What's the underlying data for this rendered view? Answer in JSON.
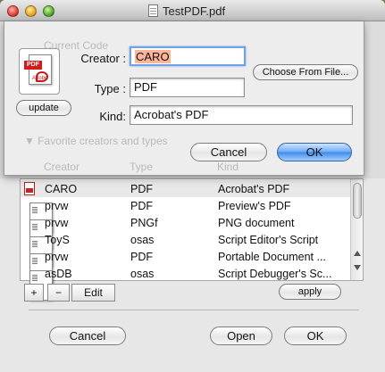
{
  "window": {
    "title": "TestPDF.pdf"
  },
  "background": {
    "ghost_label": "Current Code",
    "ghost_section": "▼ Favorite creators and types",
    "ghost_col1": "Creator",
    "ghost_col2": "Type",
    "ghost_col3": "Kind",
    "rows": [
      {
        "creator": "CARO",
        "type": "PDF",
        "kind": "Acrobat's PDF",
        "icon": "pdf-icon"
      },
      {
        "creator": "prvw",
        "type": "PDF",
        "kind": "Preview's PDF",
        "icon": "document-icon"
      },
      {
        "creator": "prvw",
        "type": "PNGf",
        "kind": "PNG document",
        "icon": "document-icon"
      },
      {
        "creator": "ToyS",
        "type": "osas",
        "kind": "Script Editor's Script",
        "icon": "document-icon"
      },
      {
        "creator": "prvw",
        "type": "PDF",
        "kind": "Portable Document ...",
        "icon": "document-icon"
      },
      {
        "creator": "asDB",
        "type": "osas",
        "kind": "Script Debugger's Sc...",
        "icon": "document-icon"
      }
    ],
    "add_label": "+",
    "remove_label": "−",
    "edit_label": "Edit",
    "apply_label": "apply",
    "cancel_label": "Cancel",
    "open_label": "Open",
    "ok_label": "OK"
  },
  "sheet": {
    "icon_band": "PDF",
    "icon_caption": "Adobe",
    "update_label": "update",
    "creator_label": "Creator :",
    "creator_value": "CARO",
    "type_label": "Type :",
    "type_value": "PDF",
    "kind_label": "Kind:",
    "kind_value": "Acrobat's PDF",
    "choose_label": "Choose From File...",
    "cancel_label": "Cancel",
    "ok_label": "OK"
  }
}
